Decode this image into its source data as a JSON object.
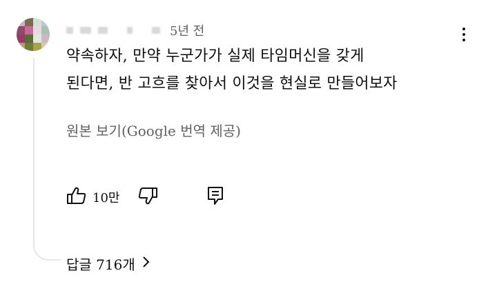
{
  "comment": {
    "timestamp": "5년 전",
    "text_lines": [
      "약속하자, 만약 누군가가 실제 타임머신을 갖게",
      "된다면, 반 고흐를 찾아서 이것을 현실로 만들어보자"
    ],
    "show_original_label": "원본 보기(Google 번역 제공)",
    "like_count": "10만",
    "replies_label": "답글 716개",
    "icons": {
      "menu": "more-vert-icon",
      "like": "thumbs-up-icon",
      "dislike": "thumbs-down-icon",
      "reply": "reply-comment-icon",
      "expand": "chevron-right-icon"
    }
  },
  "colors": {
    "text_primary": "#0f0f0f",
    "text_secondary": "#606060",
    "thread_line": "#e5e5e5"
  }
}
